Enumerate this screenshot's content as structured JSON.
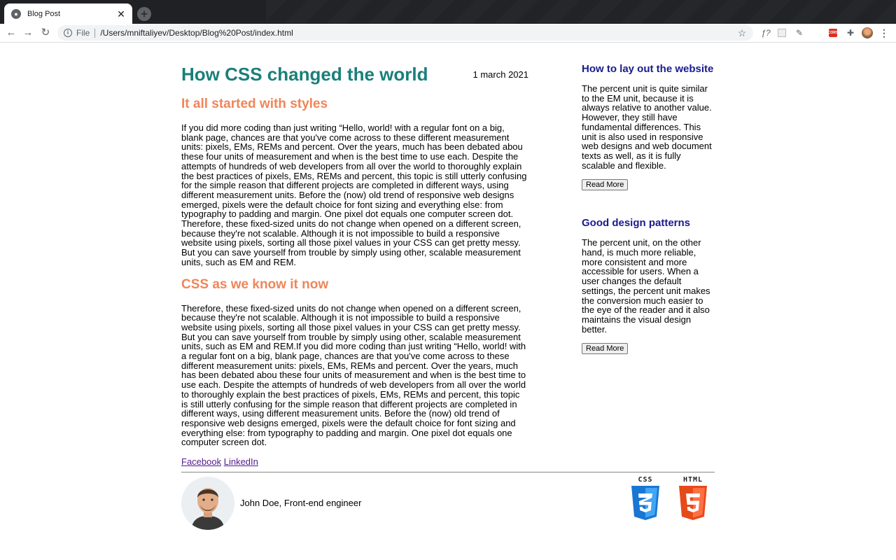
{
  "browser": {
    "tab_title": "Blog Post",
    "new_tab": "+",
    "close": "✕",
    "scheme": "File",
    "url": "/Users/mniftaliyev/Desktop/Blog%20Post/index.html",
    "extension_fx": "ƒ?",
    "extension_cors": "CORS"
  },
  "post": {
    "title": "How CSS changed the world",
    "date": "1 march 2021",
    "section1_heading": "It all started with styles",
    "section1_text": "If you did more coding than just writing “Hello, world! with a regular font on a big, blank page, chances are that you've come across to these different measurement units: pixels, EMs, REMs and percent. Over the years, much has been debated abou these four units of measurement and when is the best time to use each. Despite the attempts of hundreds of web developers from all over the world to thoroughly explain the best practices of pixels, EMs, REMs and percent, this topic is still utterly confusing for the simple reason that different projects are completed in different ways, using different measurement units. Before the (now) old trend of responsive web designs emerged, pixels were the default choice for font sizing and everything else: from typography to padding and margin. One pixel dot equals one computer screen dot. Therefore, these fixed-sized units do not change when opened on a different screen, because they're not scalable. Although it is not impossible to build a responsive website using pixels, sorting all those pixel values in your CSS can get pretty messy. But you can save yourself from trouble by simply using other, scalable measurement units, such as EM and REM.",
    "section2_heading": "CSS as we know it now",
    "section2_text": "Therefore, these fixed-sized units do not change when opened on a different screen, because they're not scalable. Although it is not impossible to build a responsive website using pixels, sorting all those pixel values in your CSS can get pretty messy. But you can save yourself from trouble by simply using other, scalable measurement units, such as EM and REM.If you did more coding than just writing “Hello, world! with a regular font on a big, blank page, chances are that you've come across to these different measurement units: pixels, EMs, REMs and percent. Over the years, much has been debated abou these four units of measurement and when is the best time to use each. Despite the attempts of hundreds of web developers from all over the world to thoroughly explain the best practices of pixels, EMs, REMs and percent, this topic is still utterly confusing for the simple reason that different projects are completed in different ways, using different measurement units. Before the (now) old trend of responsive web designs emerged, pixels were the default choice for font sizing and everything else: from typography to padding and margin. One pixel dot equals one computer screen dot.",
    "links": {
      "facebook": "Facebook",
      "linkedin": "LinkedIn"
    }
  },
  "sidebar": {
    "card1": {
      "heading": "How to lay out the website",
      "text": "The percent unit is quite similar to the EM unit, because it is always relative to another value. However, they still have fundamental differences. This unit is also used in responsive web designs and web document texts as well, as it is fully scalable and flexible.",
      "button": "Read More"
    },
    "card2": {
      "heading": "Good design patterns",
      "text": "The percent unit, on the other hand, is much more reliable, more consistent and more accessible for users. When a user changes the default settings, the percent unit makes the conversion much easier to the eye of the reader and it also maintains the visual design better.",
      "button": "Read More"
    }
  },
  "footer": {
    "author": "John Doe, Front-end engineer",
    "badge_css": "CSS",
    "badge_html": "HTML",
    "badge_css_digit": "3",
    "badge_html_digit": "5"
  },
  "colors": {
    "title": "#1a7f7a",
    "section_heading": "#f0855a",
    "aside_heading": "#1a1a8e",
    "css_blue": "#2196f3",
    "html_orange": "#f4511e"
  }
}
